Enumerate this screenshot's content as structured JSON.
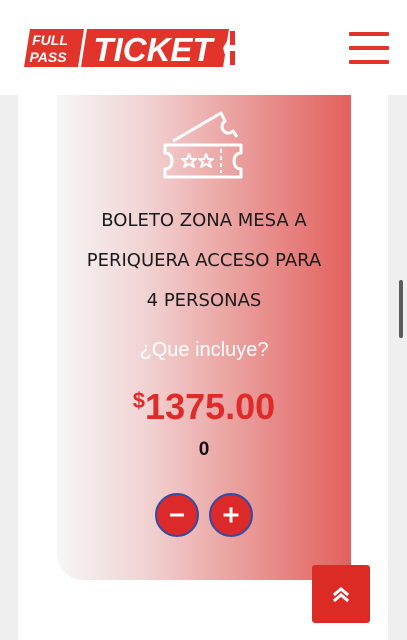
{
  "header": {
    "logo": {
      "word_top": "FULL",
      "word_bottom": "PASS",
      "word_main": "TICKET"
    },
    "menu_icon": "hamburger-menu-icon"
  },
  "product": {
    "icon": "ticket-stars-icon",
    "title_lines": [
      "BOLETO ZONA MESA A",
      "PERIQUERA ACCESO PARA",
      "4 PERSONAS"
    ],
    "includes_link": "¿Que incluye?",
    "currency_symbol": "$",
    "price": "1375.00",
    "quantity": "0"
  },
  "controls": {
    "decrement_icon": "minus-icon",
    "increment_icon": "plus-icon"
  },
  "back_to_top_icon": "chevron-double-up-icon",
  "colors": {
    "brand_red": "#e2342a",
    "price_red": "#e02a2a",
    "button_border": "#2d4ea6",
    "card_gradient_end": "#e2605d"
  }
}
